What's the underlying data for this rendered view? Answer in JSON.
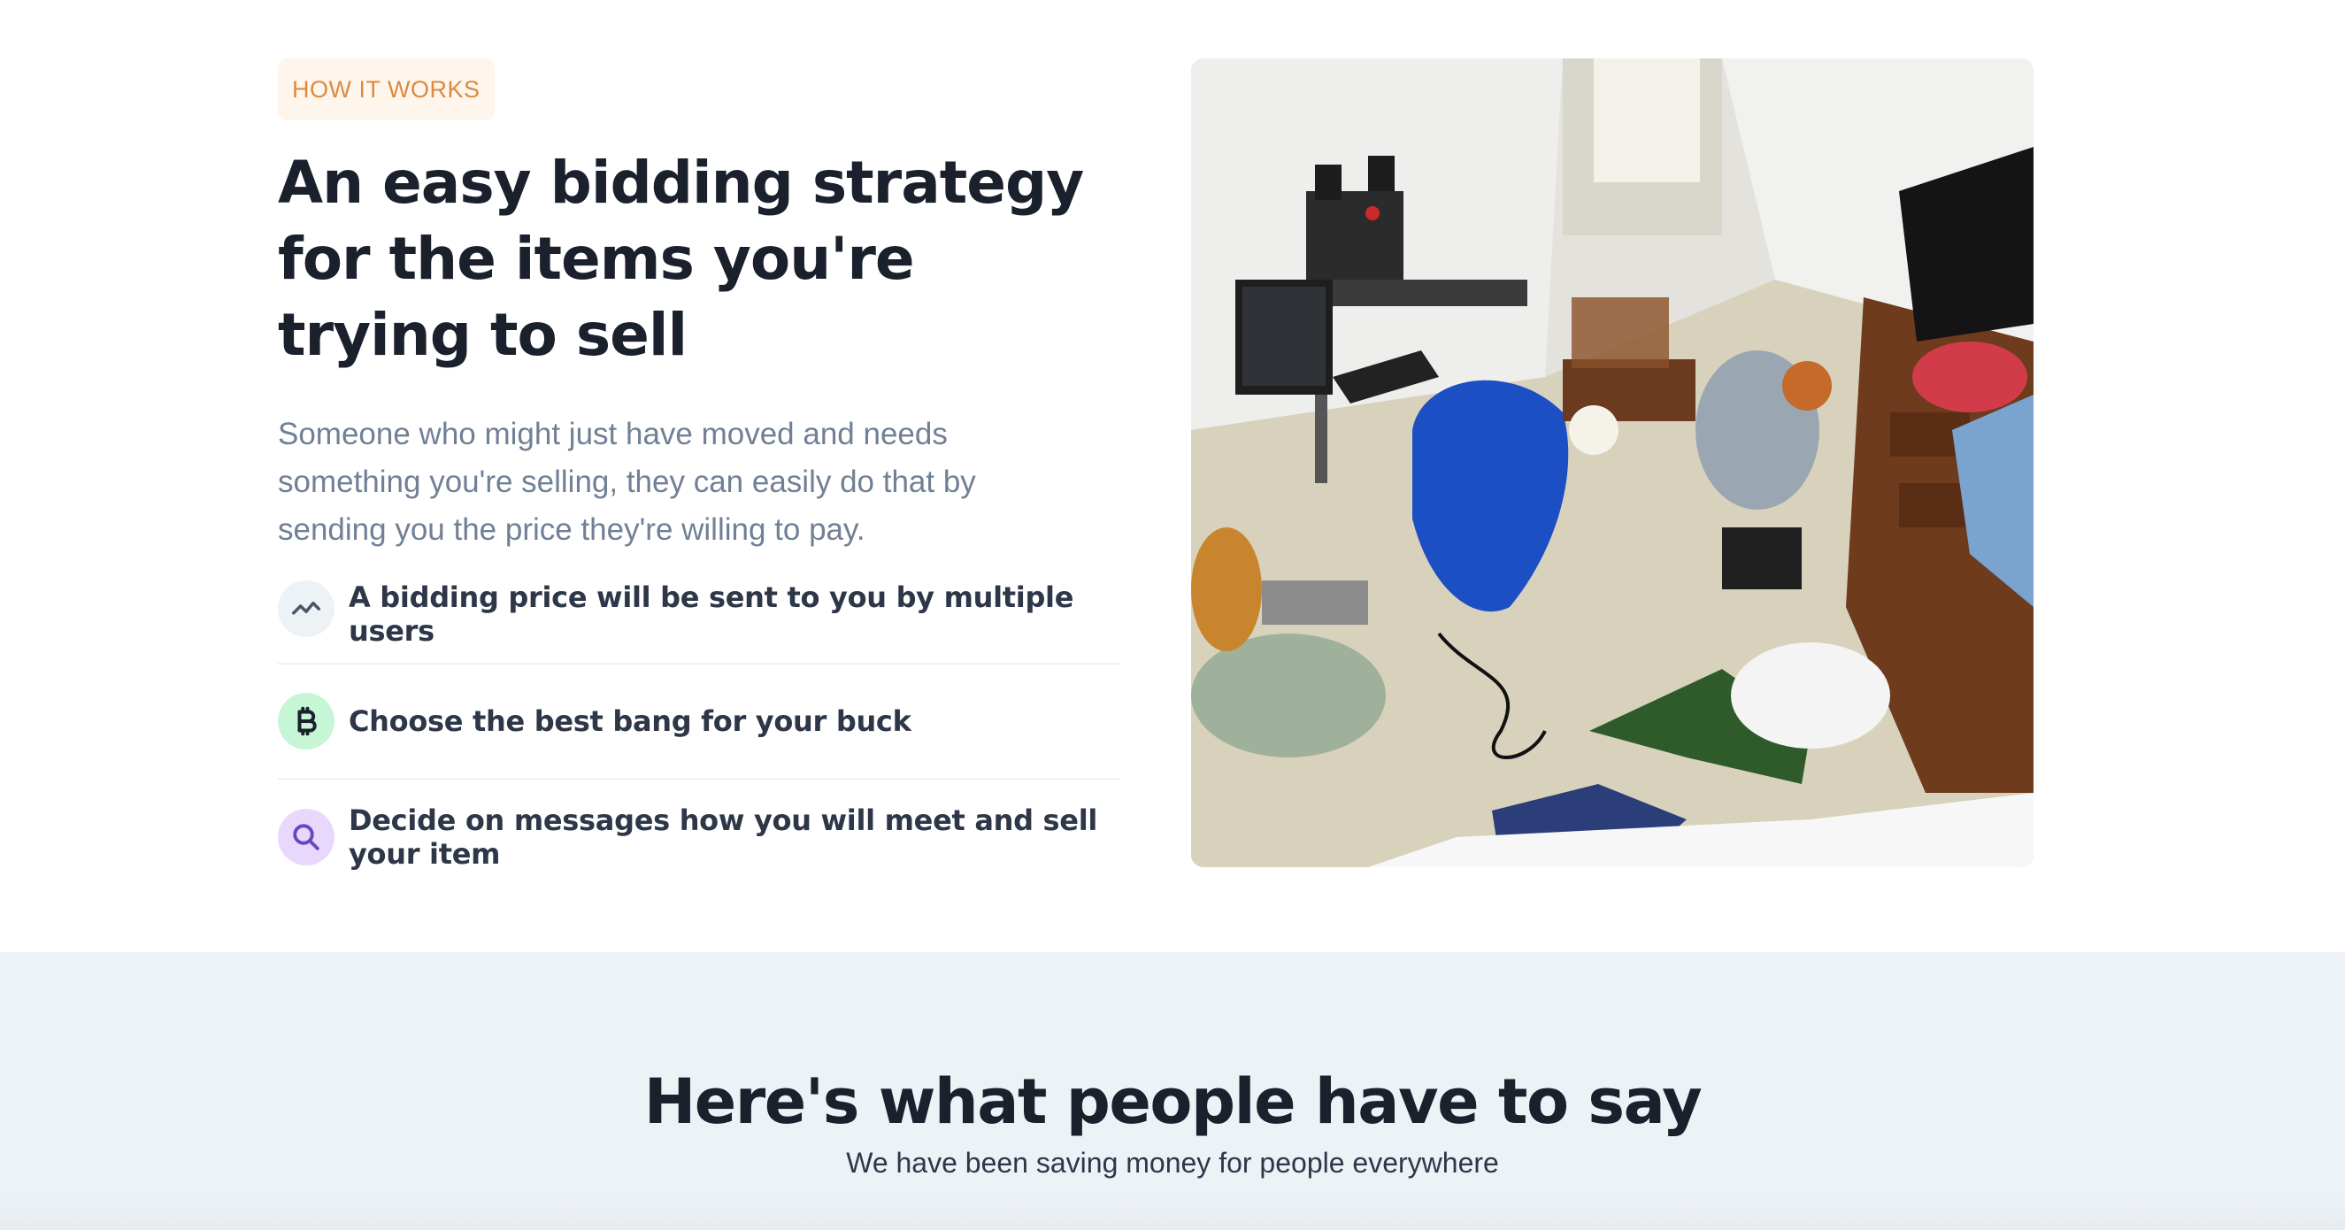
{
  "how_it_works": {
    "eyebrow": "HOW IT WORKS",
    "headline": "An easy bidding strategy for the items you're trying to sell",
    "description": "Someone who might just have moved and needs something you're selling, they can easily do that by sending you the price they're willing to pay.",
    "features": [
      {
        "label": "A bidding price will be sent to you by multiple users",
        "icon": "trending-line-icon",
        "color": "#4a5568"
      },
      {
        "label": "Choose the best bang for your buck",
        "icon": "bitcoin-icon",
        "color": "#1a202c"
      },
      {
        "label": "Decide on messages how you will meet and sell your item",
        "icon": "search-icon",
        "color": "#6b46c1"
      }
    ]
  },
  "testimonials": {
    "title": "Here's what people have to say",
    "subtitle": "We have been saving money for people everywhere"
  },
  "colors": {
    "eyebrow_bg": "#fef6ec",
    "eyebrow_text": "#dd8a3e",
    "heading": "#1a202c",
    "muted": "#718096",
    "section_bg": "#edf2f7"
  }
}
